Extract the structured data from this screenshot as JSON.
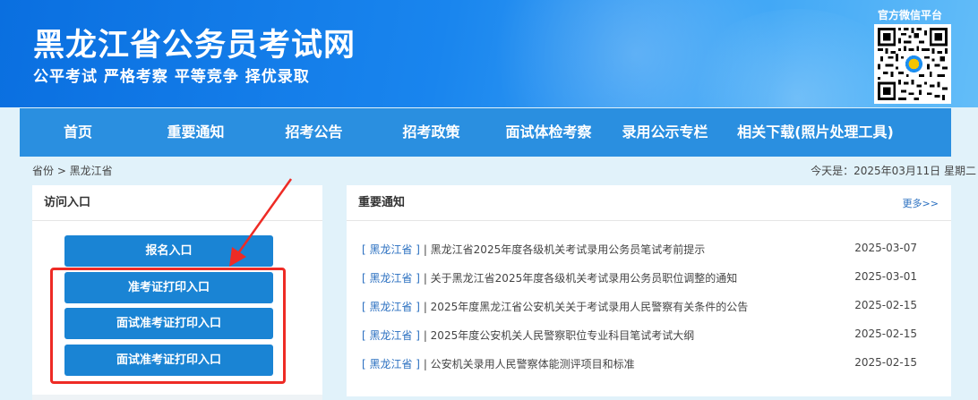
{
  "header": {
    "site_title": "黑龙江省公务员考试网",
    "slogan": "公平考试 严格考察 平等竞争 择优录取",
    "wechat_title": "官方微信平台"
  },
  "nav": {
    "items": [
      {
        "label": "首页"
      },
      {
        "label": "重要通知"
      },
      {
        "label": "招考公告"
      },
      {
        "label": "招考政策"
      },
      {
        "label": "面试体检考察"
      },
      {
        "label": "录用公示专栏"
      },
      {
        "label": "相关下载(照片处理工具)"
      }
    ]
  },
  "breadcrumb": "省份 > 黑龙江省",
  "today": "今天是：2025年03月11日 星期二",
  "left_panel": {
    "title": "访问入口",
    "buttons": [
      {
        "label": "报名入口"
      },
      {
        "label": "准考证打印入口"
      },
      {
        "label": "面试准考证打印入口"
      },
      {
        "label": "面试准考证打印入口"
      }
    ]
  },
  "right_panel": {
    "title": "重要通知",
    "more": "更多>>",
    "news": [
      {
        "tag": "[ 黑龙江省 ]",
        "title": " | 黑龙江省2025年度各级机关考试录用公务员笔试考前提示",
        "date": "2025-03-07"
      },
      {
        "tag": "[ 黑龙江省 ]",
        "title": " | 关于黑龙江省2025年度各级机关考试录用公务员职位调整的通知",
        "date": "2025-03-01"
      },
      {
        "tag": "[ 黑龙江省 ]",
        "title": " | 2025年度黑龙江省公安机关关于考试录用人民警察有关条件的公告",
        "date": "2025-02-15"
      },
      {
        "tag": "[ 黑龙江省 ]",
        "title": " | 2025年度公安机关人民警察职位专业科目笔试考试大纲",
        "date": "2025-02-15"
      },
      {
        "tag": "[ 黑龙江省 ]",
        "title": " | 公安机关录用人民警察体能测评项目和标准",
        "date": "2025-02-15"
      }
    ]
  },
  "colors": {
    "header_blue": "#1985ee",
    "nav_blue": "#2a8fe0",
    "button_blue": "#1a84d4",
    "highlight_red": "#ee2b25",
    "link_blue": "#2a6fc0"
  }
}
